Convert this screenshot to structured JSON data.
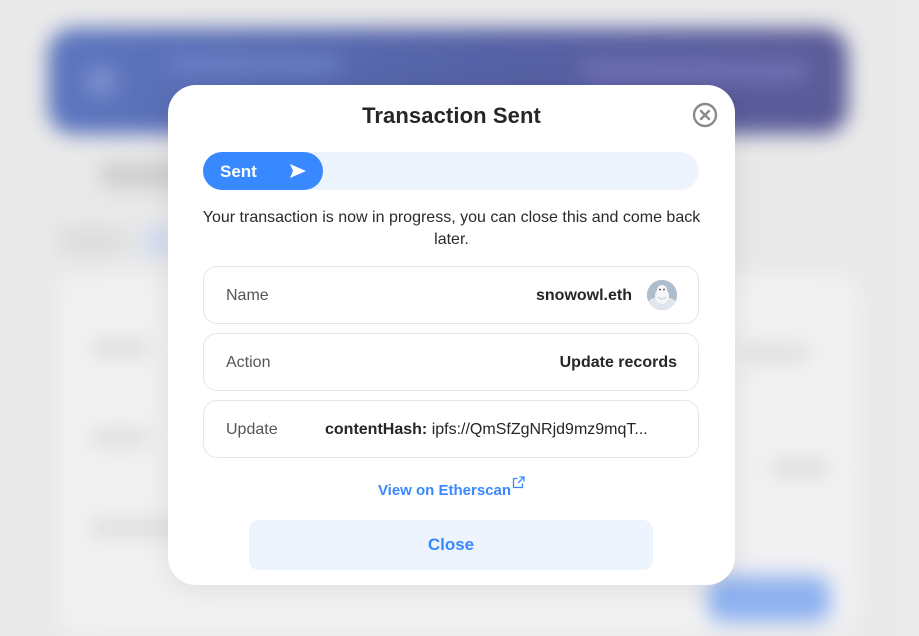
{
  "modal": {
    "title": "Transaction Sent",
    "close_icon": "close-circle-icon"
  },
  "progress": {
    "label": "Sent",
    "icon": "send-icon"
  },
  "message": "Your transaction is now in progress, you can close this and come back later.",
  "details": {
    "name": {
      "label": "Name",
      "value": "snowowl.eth",
      "avatar_icon": "avatar-icon"
    },
    "action": {
      "label": "Action",
      "value": "Update records"
    },
    "update": {
      "label": "Update",
      "key": "contentHash:",
      "value": "ipfs://QmSfZgNRjd9mz9mqT..."
    }
  },
  "etherscan": {
    "label": "View on Etherscan",
    "icon": "external-link-icon"
  },
  "close_button": {
    "label": "Close"
  },
  "colors": {
    "accent": "#3889ff",
    "accent_light": "#eef4fd",
    "text": "#262626"
  }
}
